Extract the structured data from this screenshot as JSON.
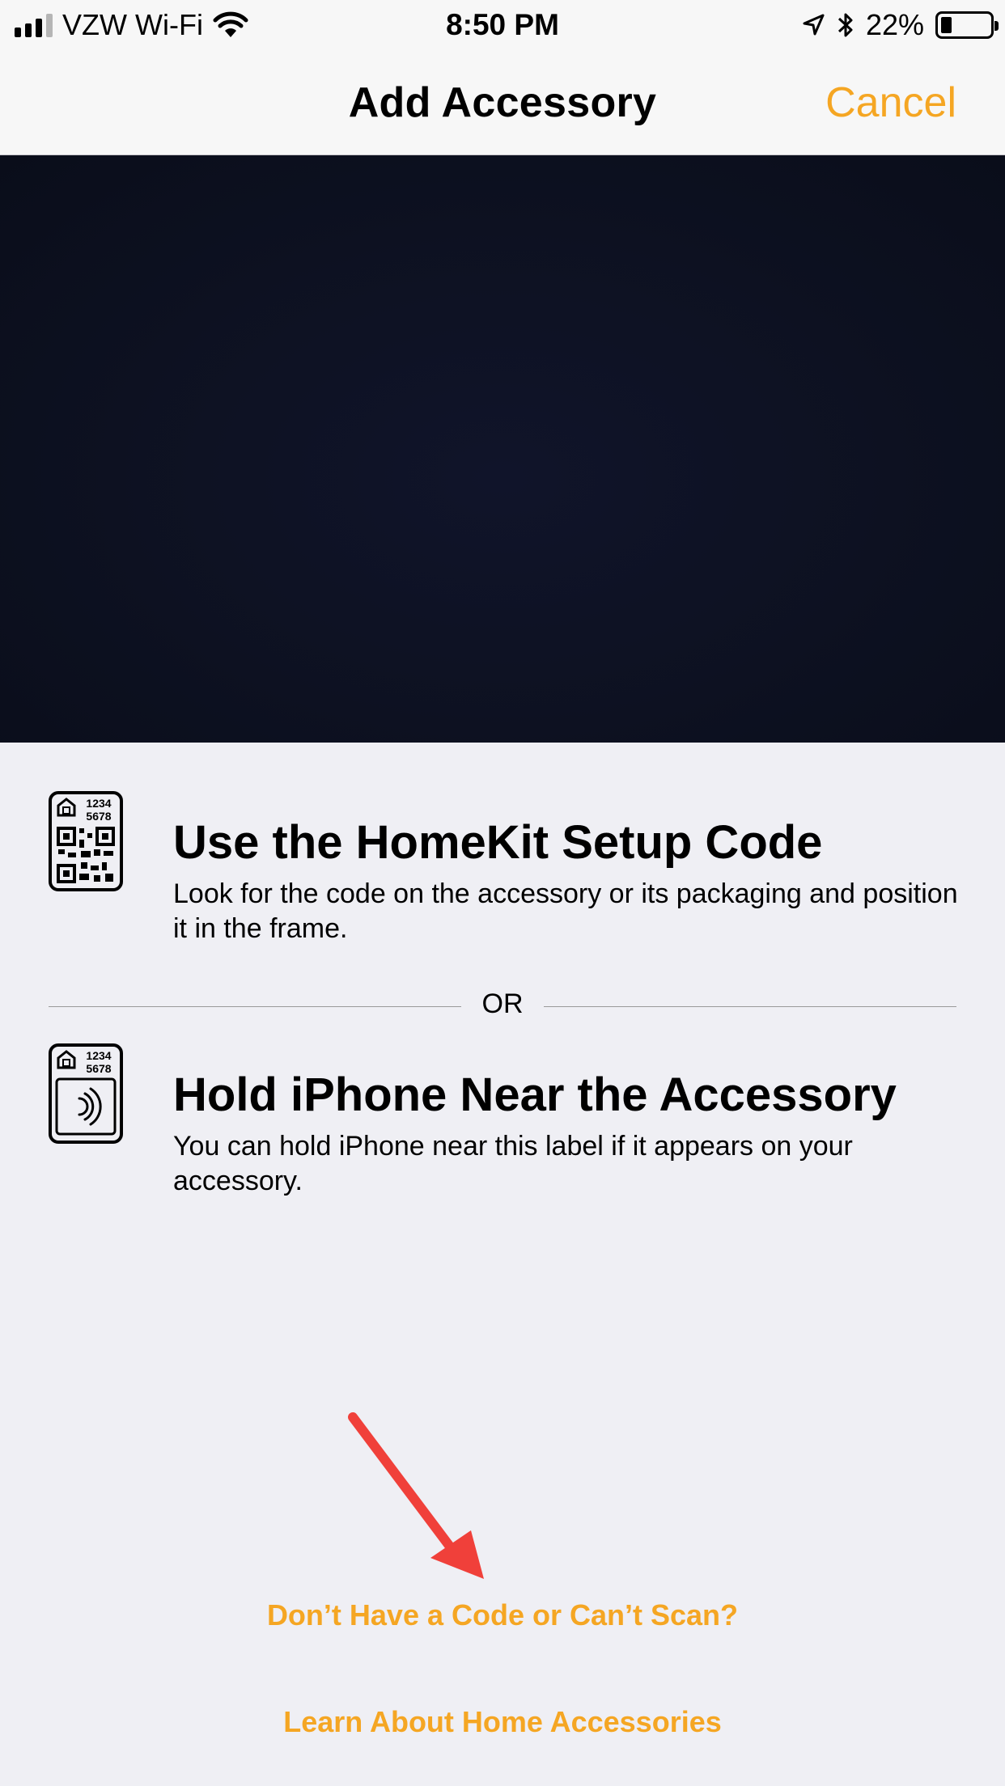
{
  "status_bar": {
    "carrier": "VZW Wi-Fi",
    "time": "8:50 PM",
    "battery_percent": "22%",
    "battery_level": 0.22
  },
  "nav": {
    "title": "Add Accessory",
    "cancel_label": "Cancel"
  },
  "options": [
    {
      "title": "Use the HomeKit Setup Code",
      "description": "Look for the code on the accessory or its packaging and position it in the frame.",
      "icon": "homekit-qr-code-icon",
      "icon_code_line1": "1234",
      "icon_code_line2": "5678"
    },
    {
      "title": "Hold iPhone Near the Accessory",
      "description": "You can hold iPhone near this label if it appears on your accessory.",
      "icon": "homekit-nfc-icon",
      "icon_code_line1": "1234",
      "icon_code_line2": "5678"
    }
  ],
  "divider_label": "OR",
  "links": {
    "no_code": "Don’t Have a Code or Can’t Scan?",
    "learn_more": "Learn About Home Accessories"
  },
  "colors": {
    "accent": "#f5a623",
    "annotation_arrow": "#f0403a",
    "background": "#efeff4",
    "viewfinder": "#0d1121"
  }
}
